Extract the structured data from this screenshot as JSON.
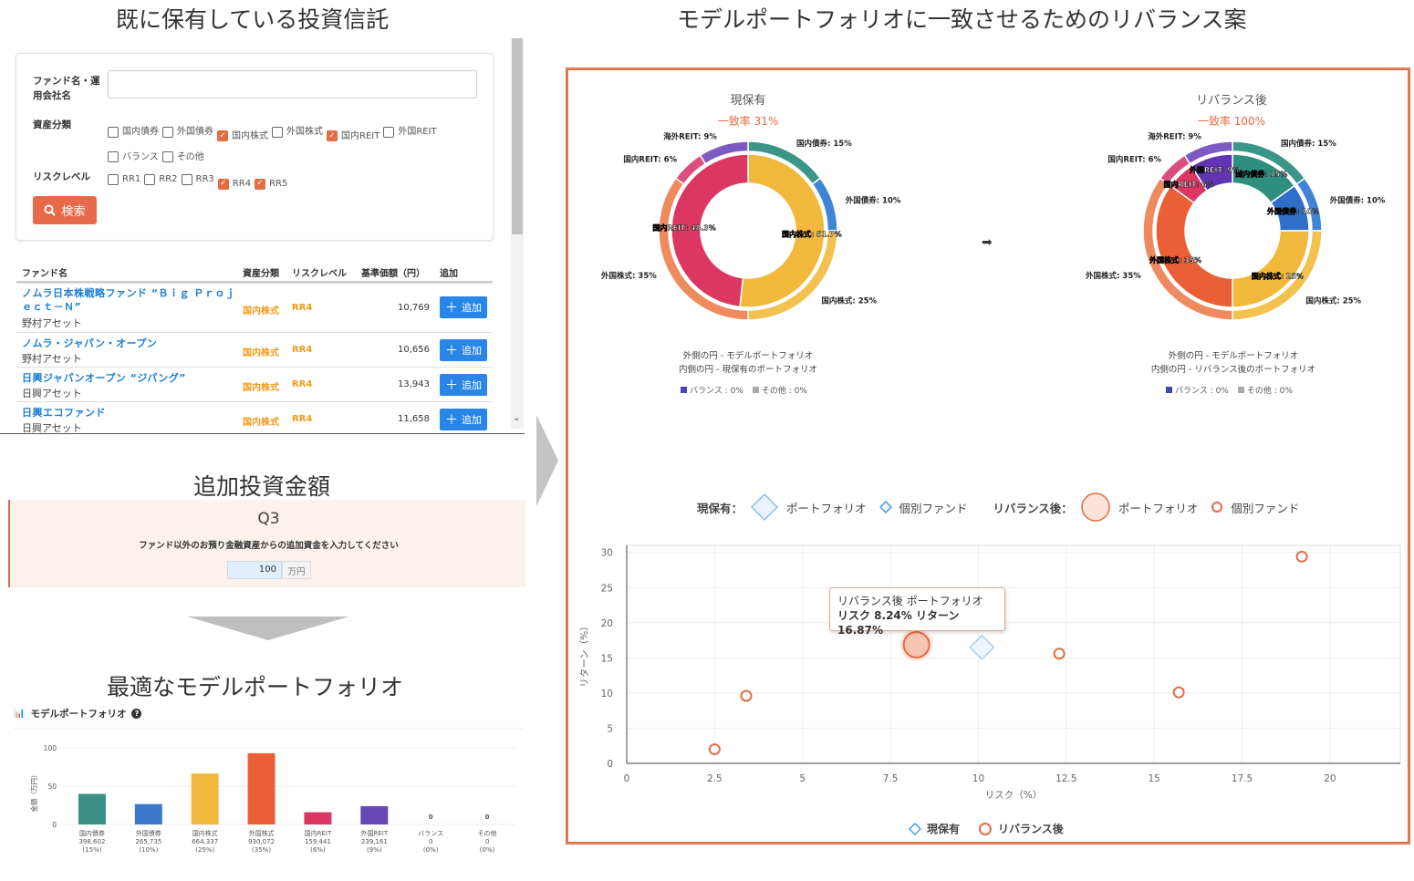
{
  "left": {
    "title_holdings": "既に保有している投資信託",
    "search": {
      "fund_label": "ファンド名・運用会社名",
      "fund_placeholder": "",
      "asset_label": "資産分類",
      "asset_options": [
        {
          "label": "国内債券",
          "checked": false
        },
        {
          "label": "外国債券",
          "checked": false
        },
        {
          "label": "国内株式",
          "checked": true
        },
        {
          "label": "外国株式",
          "checked": false
        },
        {
          "label": "国内REIT",
          "checked": true
        },
        {
          "label": "外国REIT",
          "checked": false
        },
        {
          "label": "バランス",
          "checked": false
        },
        {
          "label": "その他",
          "checked": false
        }
      ],
      "risk_label": "リスクレベル",
      "risk_options": [
        {
          "label": "RR1",
          "checked": false
        },
        {
          "label": "RR2",
          "checked": false
        },
        {
          "label": "RR3",
          "checked": false
        },
        {
          "label": "RR4",
          "checked": true
        },
        {
          "label": "RR5",
          "checked": true
        }
      ],
      "search_button": "検索"
    },
    "table": {
      "headers": [
        "ファンド名",
        "資産分類",
        "リスクレベル",
        "基準価額（円）",
        "追加"
      ],
      "rows": [
        {
          "name": "ノムラ日本株戦略ファンド “Ｂｉｇ Ｐｒｏｊｅｃｔ－Ｎ”",
          "company": "野村アセット",
          "asset": "国内株式",
          "risk": "RR4",
          "price": "10,769",
          "add": "追加"
        },
        {
          "name": "ノムラ・ジャパン・オープン",
          "company": "野村アセット",
          "asset": "国内株式",
          "risk": "RR4",
          "price": "10,656",
          "add": "追加"
        },
        {
          "name": "日興ジャパンオープン “ジパング”",
          "company": "日興アセット",
          "asset": "国内株式",
          "risk": "RR4",
          "price": "13,943",
          "add": "追加"
        },
        {
          "name": "日興エコファンド",
          "company": "日興アセット",
          "asset": "国内株式",
          "risk": "RR4",
          "price": "11,658",
          "add": "追加"
        }
      ]
    },
    "title_additional": "追加投資金額",
    "q3": {
      "label": "Q3",
      "question": "ファンド以外のお預り金融資産からの追加資金を入力してください",
      "value": "100",
      "unit": "万円"
    },
    "title_model": "最適なモデルポートフォリオ",
    "model_header": "モデルポートフォリオ",
    "bar_chart": {
      "ylabel": "金額（万円）",
      "yticks": [
        "100",
        "50",
        "0"
      ],
      "ymax": 100
    }
  },
  "right": {
    "title": "モデルポートフォリオに一致させるためのリバランス案",
    "current": {
      "title": "現保有",
      "match": "一致率 31%",
      "outer_labels": [
        "国内債券: 15%",
        "外国債券: 10%",
        "国内株式: 25%",
        "外国株式: 35%",
        "国内REIT: 6%",
        "海外REIT: 9%"
      ],
      "inner_labels": [
        "国内株式: 51.7%",
        "国内REIT: 48.3%"
      ],
      "legend_outer": "外側の円 - モデルポートフォリオ",
      "legend_inner": "内側の円 - 現保有のポートフォリオ",
      "legend_balance": "バランス : 0%",
      "legend_other": "その他 : 0%"
    },
    "arrow": "➡",
    "after": {
      "title": "リバランス後",
      "match": "一致率 100%",
      "outer_labels": [
        "国内債券: 15%",
        "外国債券: 10%",
        "国内株式: 25%",
        "外国株式: 35%",
        "国内REIT: 6%",
        "海外REIT: 9%"
      ],
      "inner_labels": [
        "国内債券: 15%",
        "外国債券: 10%",
        "国内株式: 25%",
        "外国株式: 35%",
        "国内REIT: 6%",
        "外国REIT: 9%"
      ],
      "legend_outer": "外側の円 - モデルポートフォリオ",
      "legend_inner": "内側の円 - リバランス後のポートフォリオ",
      "legend_balance": "バランス : 0%",
      "legend_other": "その他 : 0%"
    },
    "scatter_legend": {
      "current_label": "現保有：",
      "portfolio": "ポートフォリオ",
      "individual": "個別ファンド",
      "after_label": "リバランス後："
    },
    "tooltip": {
      "line1": "リバランス後 ポートフォリオ",
      "line2": "リスク 8.24% リターン 16.87%"
    },
    "bottom_legend": [
      "現保有",
      "リバランス後"
    ]
  },
  "chart_data": [
    {
      "type": "bar",
      "title": "モデルポートフォリオ",
      "ylabel": "金額（万円）",
      "ylim": [
        0,
        100
      ],
      "categories": [
        "国内債券",
        "外国債券",
        "国内株式",
        "外国株式",
        "国内REIT",
        "外国REIT",
        "バランス",
        "その他"
      ],
      "values": [
        39.9,
        26.6,
        66.4,
        93.0,
        15.9,
        23.9,
        0,
        0
      ],
      "amounts": [
        "398,602",
        "265,735",
        "664,337",
        "930,072",
        "159,441",
        "239,161",
        "0",
        "0"
      ],
      "percents": [
        "(15%)",
        "(10%)",
        "(25%)",
        "(35%)",
        "(6%)",
        "(9%)",
        "(0%)",
        "(0%)"
      ],
      "colors": [
        "#3a9085",
        "#3d79c9",
        "#f2b83b",
        "#ea5f36",
        "#db3762",
        "#6548b3",
        "#888888",
        "#888888"
      ]
    },
    {
      "type": "pie",
      "title": "現保有",
      "outer": [
        {
          "name": "国内債券",
          "value": 15,
          "color": "#3a9688"
        },
        {
          "name": "外国債券",
          "value": 10,
          "color": "#3f84d6"
        },
        {
          "name": "国内株式",
          "value": 25,
          "color": "#f2c14e"
        },
        {
          "name": "外国株式",
          "value": 35,
          "color": "#ee8a5e"
        },
        {
          "name": "国内REIT",
          "value": 6,
          "color": "#dd4d7e"
        },
        {
          "name": "海外REIT",
          "value": 9,
          "color": "#7d59c2"
        }
      ],
      "inner": [
        {
          "name": "国内株式",
          "value": 51.7,
          "color": "#f2b83b"
        },
        {
          "name": "国内REIT",
          "value": 48.3,
          "color": "#db3762"
        }
      ]
    },
    {
      "type": "pie",
      "title": "リバランス後",
      "outer": [
        {
          "name": "国内債券",
          "value": 15,
          "color": "#3a9688"
        },
        {
          "name": "外国債券",
          "value": 10,
          "color": "#3f84d6"
        },
        {
          "name": "国内株式",
          "value": 25,
          "color": "#f2c14e"
        },
        {
          "name": "外国株式",
          "value": 35,
          "color": "#ee8a5e"
        },
        {
          "name": "国内REIT",
          "value": 6,
          "color": "#dd4d7e"
        },
        {
          "name": "海外REIT",
          "value": 9,
          "color": "#7d59c2"
        }
      ],
      "inner": [
        {
          "name": "国内債券",
          "value": 15,
          "color": "#2f8f7f"
        },
        {
          "name": "外国債券",
          "value": 10,
          "color": "#2f6fc9"
        },
        {
          "name": "国内株式",
          "value": 25,
          "color": "#f2b83b"
        },
        {
          "name": "外国株式",
          "value": 35,
          "color": "#ea5f36"
        },
        {
          "name": "国内REIT",
          "value": 6,
          "color": "#db3762"
        },
        {
          "name": "外国REIT",
          "value": 9,
          "color": "#6233b3"
        }
      ]
    },
    {
      "type": "scatter",
      "xlabel": "リスク（%）",
      "ylabel": "リターン（%）",
      "xlim": [
        0,
        22
      ],
      "ylim": [
        0,
        31
      ],
      "xticks": [
        "0",
        "2.5",
        "5",
        "7.5",
        "10",
        "12.5",
        "15",
        "17.5",
        "20"
      ],
      "yticks": [
        "0",
        "5",
        "10",
        "15",
        "20",
        "25",
        "30"
      ],
      "series": [
        {
          "name": "現保有",
          "points": [
            {
              "x": 10.1,
              "y": 16.5,
              "kind": "portfolio"
            }
          ]
        },
        {
          "name": "リバランス後",
          "points": [
            {
              "x": 8.24,
              "y": 16.87,
              "kind": "portfolio"
            },
            {
              "x": 2.5,
              "y": 2.0,
              "kind": "fund"
            },
            {
              "x": 3.4,
              "y": 9.6,
              "kind": "fund"
            },
            {
              "x": 12.3,
              "y": 15.6,
              "kind": "fund"
            },
            {
              "x": 15.7,
              "y": 10.1,
              "kind": "fund"
            },
            {
              "x": 19.2,
              "y": 29.4,
              "kind": "fund"
            }
          ]
        }
      ]
    }
  ]
}
